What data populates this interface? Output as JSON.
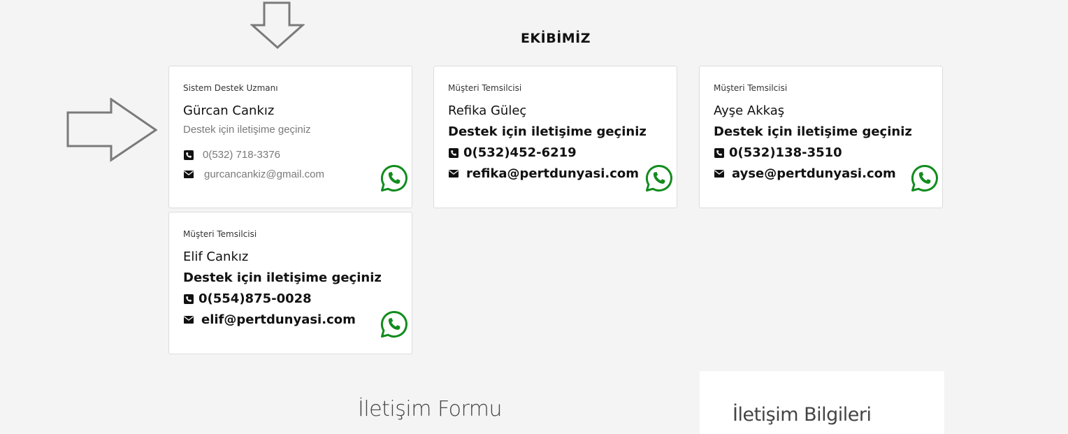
{
  "section": {
    "title": "EKİBİMİZ"
  },
  "team": [
    {
      "role": "Sistem Destek Uzmanı",
      "name": "Gürcan Cankız",
      "tagline": "Destek için iletişime geçiniz",
      "phone": "0(532) 718-3376",
      "email": "gurcancankiz@gmail.com"
    },
    {
      "role": "Müşteri Temsilcisi",
      "name": "Refika Güleç",
      "tagline": "Destek için iletişime geçiniz",
      "phone": "0(532)452-6219",
      "email": "refika@pertdunyasi.com"
    },
    {
      "role": "Müşteri Temsilcisi",
      "name": "Ayşe Akkaş",
      "tagline": "Destek için iletişime geçiniz",
      "phone": "0(532)138-3510",
      "email": "ayse@pertdunyasi.com"
    },
    {
      "role": "Müşteri Temsilcisi",
      "name": "Elif Cankız",
      "tagline": "Destek için iletişime geçiniz",
      "phone": "0(554)875-0028",
      "email": "elif@pertdunyasi.com"
    }
  ],
  "contact_form": {
    "title": "İletişim Formu"
  },
  "contact_info": {
    "title": "İletişim Bilgileri"
  },
  "icons": {
    "phone": "phone-square-icon",
    "email": "envelope-icon",
    "whatsapp": "whatsapp-icon",
    "annotation": "outline-arrow-icon"
  },
  "colors": {
    "whatsapp": "#128c1e",
    "background": "#f4f4f4",
    "muted_text": "#7a7a7a"
  }
}
